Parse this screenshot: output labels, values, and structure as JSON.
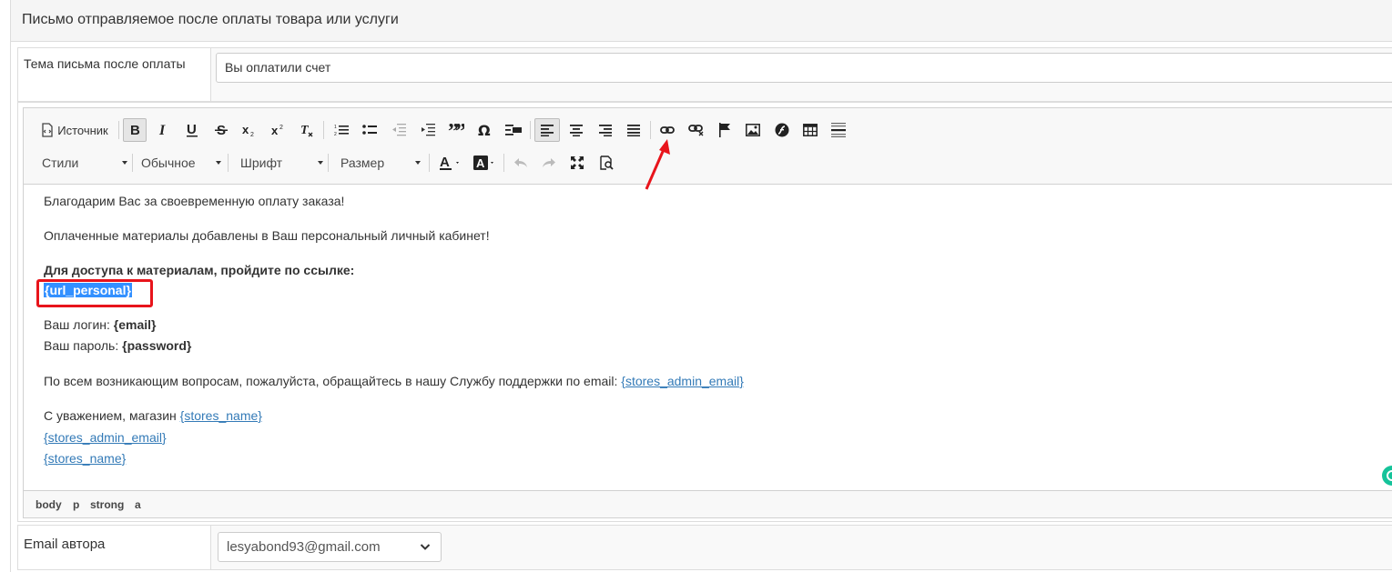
{
  "panel": {
    "title": "Письмо отправляемое после оплаты товара или услуги"
  },
  "subject": {
    "label": "Тема письма после оплаты",
    "value": "Вы оплатили счет"
  },
  "toolbar": {
    "source_label": "Источник",
    "combos": {
      "styles": "Стили",
      "format": "Обычное",
      "font": "Шрифт",
      "size": "Размер"
    },
    "icons": [
      "source-icon",
      "bold-icon",
      "italic-icon",
      "underline-icon",
      "strike-icon",
      "subscript-icon",
      "superscript-icon",
      "remove-format-icon",
      "numbered-list-icon",
      "bulleted-list-icon",
      "outdent-icon",
      "indent-icon",
      "blockquote-icon",
      "special-char-icon",
      "create-div-icon",
      "align-left-icon",
      "align-center-icon",
      "align-right-icon",
      "justify-icon",
      "link-icon",
      "unlink-icon",
      "anchor-icon",
      "image-icon",
      "flash-icon",
      "table-icon",
      "horizontal-line-icon",
      "text-color-icon",
      "bg-color-icon",
      "undo-icon",
      "redo-icon",
      "maximize-icon",
      "preview-icon"
    ]
  },
  "content": {
    "line1": "Благодарим Вас за своевременную оплату заказа!",
    "line2": "Оплаченные материалы добавлены в Ваш персональный личный кабинет!",
    "line3": "Для доступа к материалам, пройдите по ссылке:",
    "url_personal": "{url_personal}",
    "login_label": "Ваш логин: ",
    "login_value": "{email}",
    "password_label": "Ваш пароль: ",
    "password_value": "{password}",
    "support_text": "По всем возникающим вопросам, пожалуйста, обращайтесь в нашу Службу поддержки по email: ",
    "support_email": "{stores_admin_email}",
    "regards_text": "С уважением, магазин ",
    "store_name": "{stores_name}",
    "footer_email": "{stores_admin_email}",
    "footer_store": "{stores_name}"
  },
  "elements_path": [
    "body",
    "p",
    "strong",
    "a"
  ],
  "author": {
    "label": "Email автора",
    "value": "lesyabond93@gmail.com"
  },
  "colors": {
    "selection": "#3390ff",
    "link": "#337ab7",
    "annotation_red": "#e8141b"
  }
}
